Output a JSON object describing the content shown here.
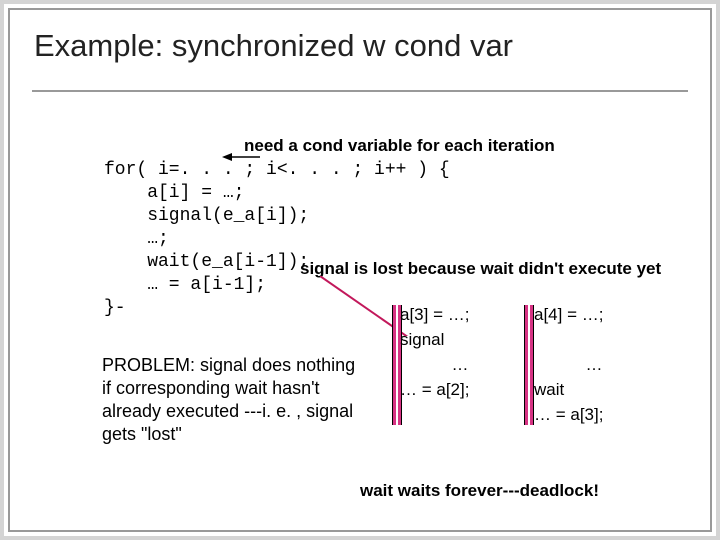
{
  "title": "Example: synchronized w cond var",
  "top_note": "need a cond variable for each iteration",
  "code": "for( i=. . . ; i<. . . ; i++ ) {\n    a[i] = …;\n    signal(e_a[i]);\n    …;\n    wait(e_a[i-1]);\n    … = a[i-1];\n}-",
  "signal_note": "signal is lost because wait didn't execute yet",
  "col3": {
    "l1": "a[3] = …;",
    "l2": "signal",
    "l3": "…",
    "l4": "… = a[2];"
  },
  "col4": {
    "l1": "a[4] = …;",
    "l2": "",
    "l3": "…",
    "l4a": "wait",
    "l4": "… = a[3];"
  },
  "problem": "PROBLEM: signal does nothing if corresponding wait hasn't already executed ---i. e. , signal gets \"lost\"",
  "bottom": "wait waits forever---deadlock!"
}
